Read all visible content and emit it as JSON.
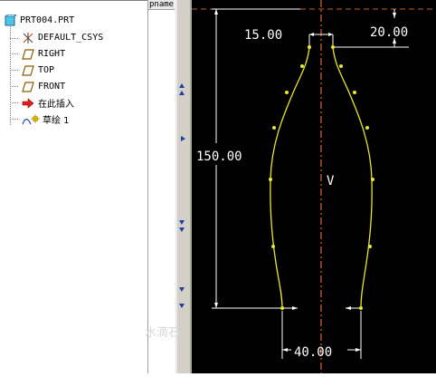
{
  "tree": {
    "root": "PRT004.PRT",
    "items": [
      "DEFAULT_CSYS",
      "RIGHT",
      "TOP",
      "FRONT",
      "在此插入",
      "草绘 1"
    ]
  },
  "column": {
    "header": "pname"
  },
  "sketch": {
    "dims": {
      "top_width": "15.00",
      "top_offset": "20.00",
      "height": "150.00",
      "bottom_width": "40.00",
      "symmetry": "V"
    }
  },
  "watermark": "水滴石",
  "colors": {
    "sketch_line": "#e8e830",
    "dimension": "#ffffff",
    "centerline": "#ff8040",
    "background": "#000000"
  }
}
